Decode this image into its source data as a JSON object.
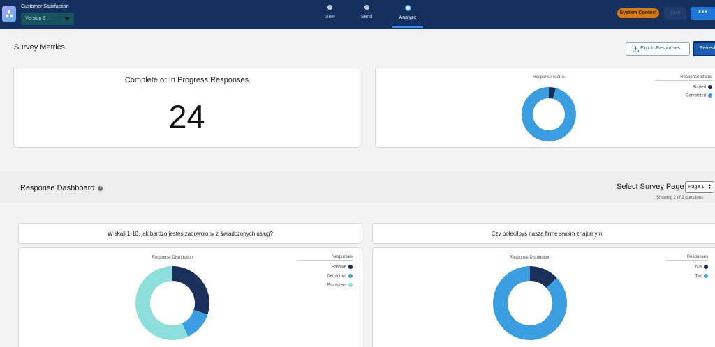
{
  "header": {
    "app_title": "Customer Satisfaction",
    "version": "Version 3",
    "steps": [
      {
        "label": "View"
      },
      {
        "label": "Send"
      },
      {
        "label": "Analyze",
        "active": true
      }
    ],
    "context_badge": "System Context",
    "save_label": "Save",
    "more_label": "•••"
  },
  "metrics": {
    "title": "Survey Metrics",
    "export_label": "Export Responses",
    "refresh_label": "Refresh",
    "count_label": "Complete or In Progress Responses",
    "count_value": "24"
  },
  "dashboard": {
    "title": "Response Dashboard",
    "info_glyph": "i",
    "page_label": "Select Survey Page",
    "page_value": "Page 1",
    "showing_text": "Showing 2 of 2 questions"
  },
  "colors": {
    "dark_navy": "#1b2f5b",
    "blue": "#3b9ee0",
    "teal": "#8ddfdb"
  },
  "chart_data": [
    {
      "type": "pie",
      "title": "Response Status",
      "legend_title": "Response Status",
      "legend_position": "top-right",
      "categories": [
        "Started",
        "Completed"
      ],
      "values": [
        1,
        23
      ],
      "colors": [
        "#1b2f5b",
        "#3b9ee0"
      ]
    },
    {
      "type": "pie",
      "question": "W skali 1-10, jak bardzo jesteś zadowolony z świadczonych usług?",
      "title": "Response Distribution",
      "legend_title": "Responses",
      "legend_position": "top-right",
      "categories": [
        "Passive",
        "Detractors",
        "Promoters"
      ],
      "values": [
        30,
        13,
        57
      ],
      "colors": [
        "#1b2f5b",
        "#3b9ee0",
        "#8ddfdb"
      ]
    },
    {
      "type": "pie",
      "question": "Czy poleciłbyś naszą firmę swoim znajomym",
      "title": "Response Distribution",
      "legend_title": "Responses",
      "legend_position": "top-right",
      "categories": [
        "Nie",
        "Tak"
      ],
      "values": [
        13,
        87
      ],
      "colors": [
        "#1b2f5b",
        "#3b9ee0"
      ]
    }
  ]
}
